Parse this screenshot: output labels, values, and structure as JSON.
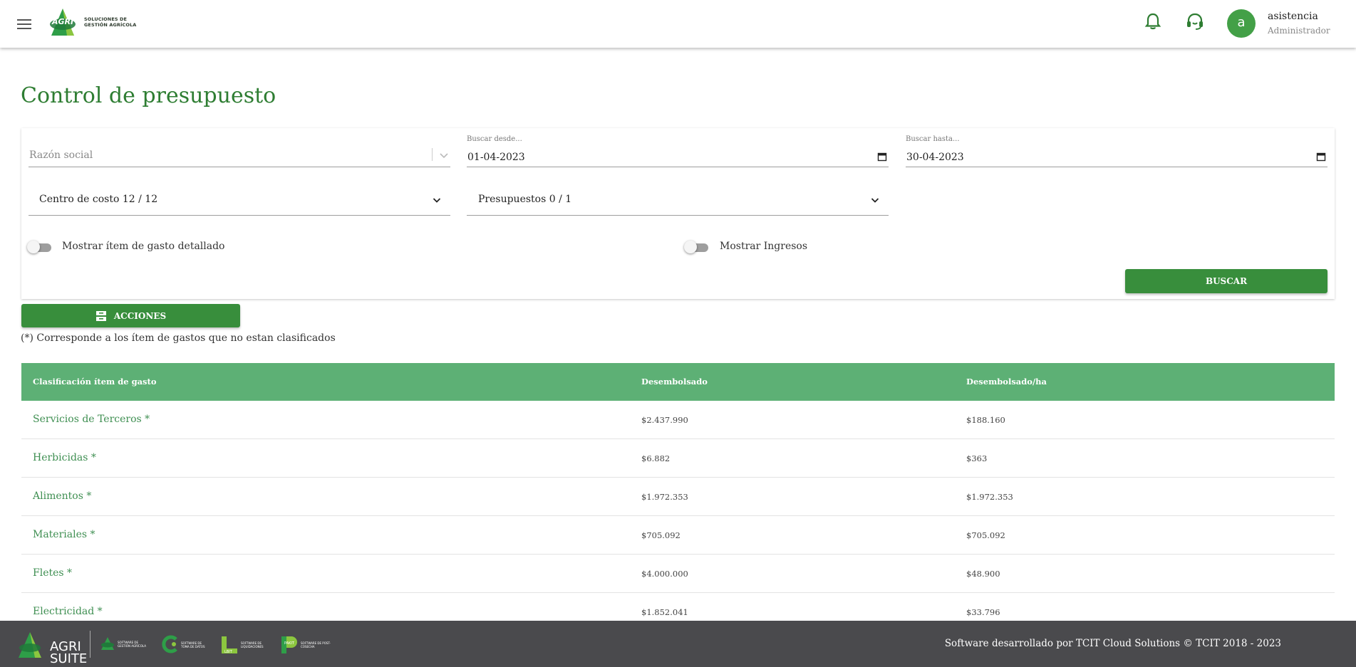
{
  "header": {
    "logo_mark_text": "AGRI",
    "logo_subtitle": "SOLUCIONES DE GESTIÓN AGRÍCOLA",
    "icons": [
      "menu-icon",
      "bell-icon",
      "headset-icon"
    ],
    "avatar_letter": "a",
    "user_name": "asistencia",
    "user_role": "Administrador"
  },
  "page": {
    "title": "Control de presupuesto"
  },
  "filters": {
    "razon_social_placeholder": "Razón social",
    "desde_label": "Buscar desde...",
    "desde_value": "01-04-2023",
    "hasta_label": "Buscar hasta...",
    "hasta_value": "30-04-2023",
    "centro_costo": "Centro de costo 12 / 12",
    "presupuestos": "Presupuestos 0 / 1",
    "toggle_detalle_label": "Mostrar ítem de gasto detallado",
    "toggle_ingresos_label": "Mostrar Ingresos",
    "buscar_label": "BUSCAR"
  },
  "actions": {
    "acciones_label": "ACCIONES"
  },
  "note": "(*) Corresponde a los ítem de gastos que no estan clasificados",
  "table": {
    "headers": [
      "Clasificación ítem de gasto",
      "Desembolsado",
      "Desembolsado/ha"
    ],
    "rows": [
      {
        "name": "Servicios de Terceros *",
        "desembolsado": "$2.437.990",
        "por_ha": "$188.160"
      },
      {
        "name": "Herbicidas *",
        "desembolsado": "$6.882",
        "por_ha": "$363"
      },
      {
        "name": "Alimentos *",
        "desembolsado": "$1.972.353",
        "por_ha": "$1.972.353"
      },
      {
        "name": "Materiales *",
        "desembolsado": "$705.092",
        "por_ha": "$705.092"
      },
      {
        "name": "Fletes *",
        "desembolsado": "$4.000.000",
        "por_ha": "$48.900"
      },
      {
        "name": "Electricidad *",
        "desembolsado": "$1.852.041",
        "por_ha": "$33.796"
      }
    ]
  },
  "footer": {
    "brand_line1": "AGRI",
    "brand_line2": "SUITE",
    "credit": "Software desarrollado por TCIT Cloud Solutions © TCIT 2018 - 2023",
    "sub_brands": [
      {
        "mark": "AGRI",
        "text": "SOFTWARE DE GESTIÓN AGRÍCOLA"
      },
      {
        "mark": "",
        "text": "SOFTWARE DE TOMA DE DATOS"
      },
      {
        "mark": "LBIT",
        "text": "SOFTWARE DE LIQUIDACIONES"
      },
      {
        "mark": "PAKIT",
        "text": "SOFTWARE DE POST-COSECHA"
      }
    ]
  },
  "colors": {
    "brand_green": "#2e7d32",
    "button_green": "#388e3c",
    "table_header": "#5db075",
    "footer_bg": "#4a4a4d"
  }
}
